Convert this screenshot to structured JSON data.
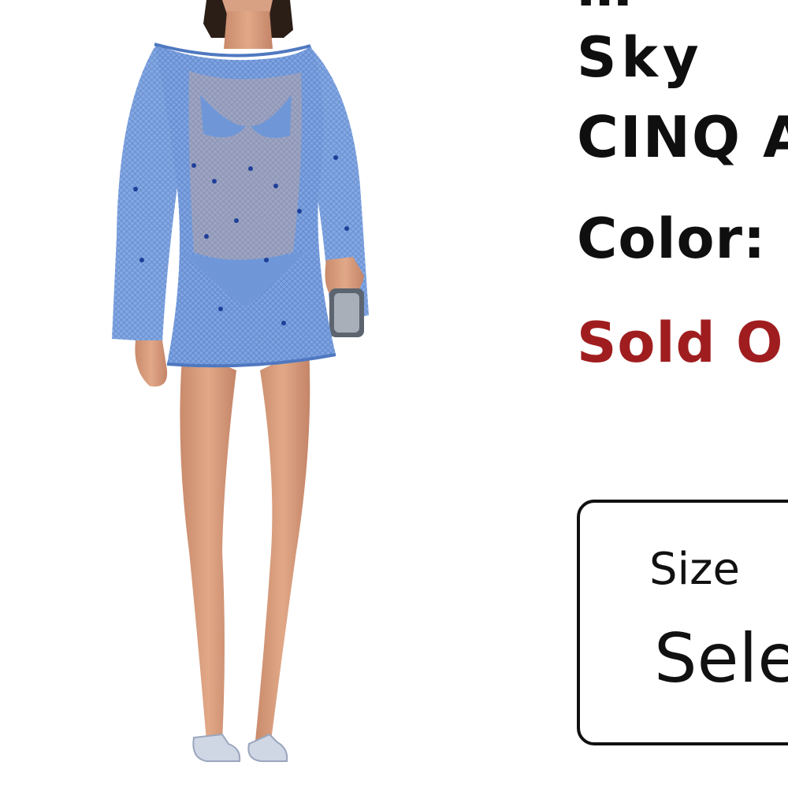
{
  "product": {
    "title_partial": "Sky",
    "brand_partial": "CINQ A",
    "color_label": "Color:",
    "stock_status": "Sold O",
    "stock_color": "#a01d1f"
  },
  "size_select": {
    "label": "Size",
    "value_partial": "Sele"
  },
  "image": {
    "alt_icon": "product-photo",
    "dress_color": "#6f97d8"
  }
}
